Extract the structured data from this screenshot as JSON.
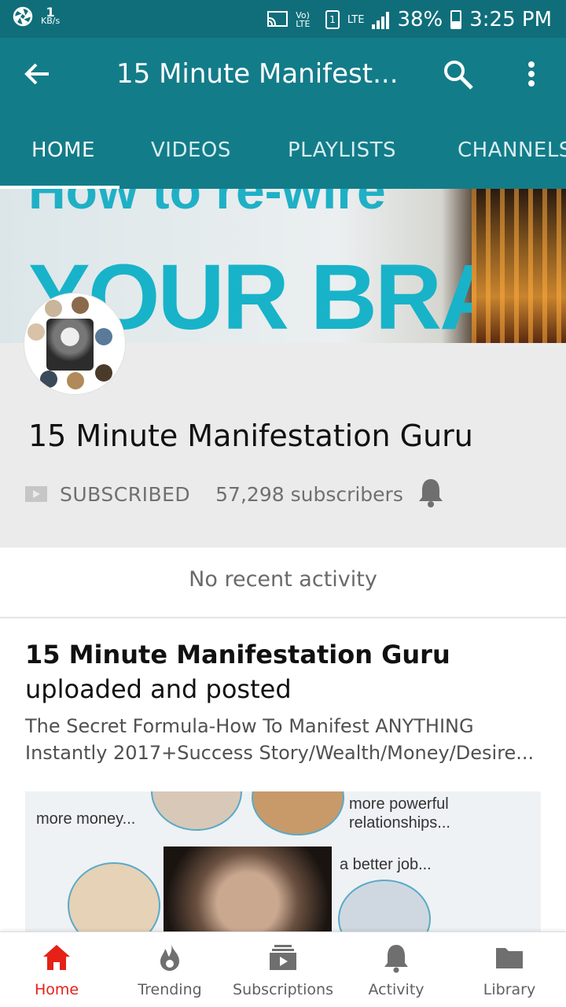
{
  "status_bar": {
    "net_speed_value": "1",
    "net_speed_unit": "KB/s",
    "volte": "Vo) LTE",
    "sim": "1",
    "lte": "LTE",
    "battery": "38%",
    "time": "3:25 PM"
  },
  "app_bar": {
    "title": "15 Minute Manifest...",
    "icons": [
      "back-arrow-icon",
      "search-icon",
      "more-vert-icon"
    ]
  },
  "tabs": [
    {
      "label": "HOME",
      "active": true
    },
    {
      "label": "VIDEOS",
      "active": false
    },
    {
      "label": "PLAYLISTS",
      "active": false
    },
    {
      "label": "CHANNELS",
      "active": false
    }
  ],
  "banner": {
    "line1": "How to re-wire",
    "line2": "YOUR BRAIN"
  },
  "channel": {
    "name": "15 Minute Manifestation Guru",
    "subscribe_label": "SUBSCRIBED",
    "subscriber_count": "57,298 subscribers"
  },
  "activity": {
    "empty_text": "No recent activity"
  },
  "post": {
    "author": "15 Minute Manifestation Guru",
    "action": "uploaded and posted",
    "desc_line1": "The Secret Formula-How To Manifest ANYTHING",
    "desc_line2": "Instantly 2017+Success Story/Wealth/Money/Desire...",
    "thumb_text1": "more money...",
    "thumb_text2a": "more powerful",
    "thumb_text2b": "relationships...",
    "thumb_text3": "a better job..."
  },
  "bottom_nav": [
    {
      "label": "Home",
      "icon": "home-icon",
      "active": true
    },
    {
      "label": "Trending",
      "icon": "flame-icon",
      "active": false
    },
    {
      "label": "Subscriptions",
      "icon": "subscriptions-icon",
      "active": false
    },
    {
      "label": "Activity",
      "icon": "bell-icon",
      "active": false
    },
    {
      "label": "Library",
      "icon": "folder-icon",
      "active": false
    }
  ],
  "colors": {
    "status_bar": "#0f6e7a",
    "app_bar": "#137c89",
    "active_red": "#e62117"
  }
}
